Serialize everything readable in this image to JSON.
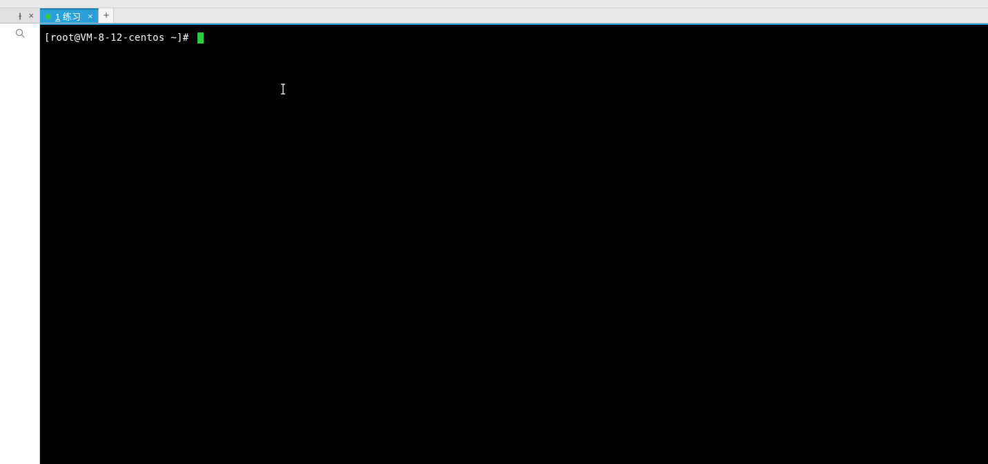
{
  "tabs": {
    "active": {
      "number": "1",
      "label": "练习",
      "status_color": "#2ecc40"
    }
  },
  "terminal": {
    "prompt": "[root@VM-8-12-centos ~]# ",
    "cursor_color": "#2ecc40"
  },
  "icons": {
    "pin": "pin-icon",
    "close": "×",
    "new_tab": "+",
    "search": "search-icon"
  }
}
